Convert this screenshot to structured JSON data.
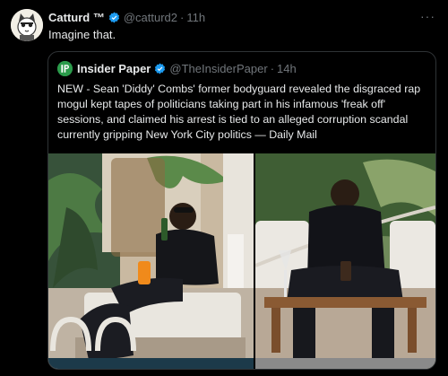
{
  "tweet": {
    "author_name": "Catturd ™",
    "author_handle": "@catturd2",
    "separator": "·",
    "time": "11h",
    "text": "Imagine that.",
    "more": "···"
  },
  "quote": {
    "author_name": "Insider Paper",
    "author_handle": "@TheInsiderPaper",
    "separator": "·",
    "time": "14h",
    "logo_letters": "IP",
    "text": "NEW - Sean 'Diddy' Combs' former bodyguard revealed the disgraced rap mogul kept tapes of politicians taking part in his infamous 'freak off' sessions, and claimed his arrest is tied to an alleged corruption scandal currently gripping New York City politics — Daily Mail"
  },
  "colors": {
    "verified": "#1d9bf0",
    "muted": "#71767b",
    "logo_green": "#2b9b4b"
  }
}
